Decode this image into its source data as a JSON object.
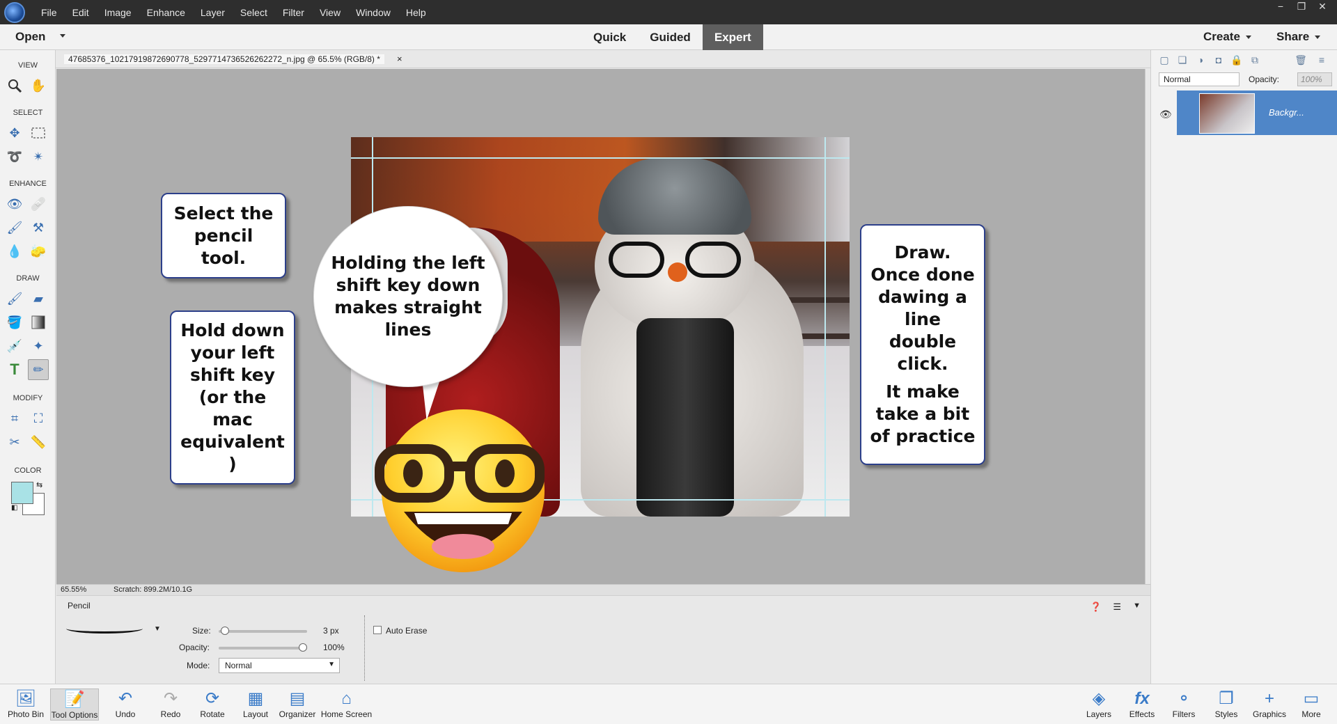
{
  "menubar": {
    "items": [
      "File",
      "Edit",
      "Image",
      "Enhance",
      "Layer",
      "Select",
      "Filter",
      "View",
      "Window",
      "Help"
    ],
    "window_controls": [
      "−",
      "❐",
      "✕"
    ]
  },
  "topbar": {
    "open_label": "Open",
    "modes": [
      "Quick",
      "Guided",
      "Expert"
    ],
    "active_mode": "Expert",
    "create_label": "Create",
    "share_label": "Share"
  },
  "toolbox": {
    "sections": [
      "VIEW",
      "SELECT",
      "ENHANCE",
      "DRAW",
      "MODIFY",
      "COLOR"
    ],
    "foreground_color": "#a9e2e6",
    "background_color": "#ffffff"
  },
  "document": {
    "tab_label": "47685376_10217919872690778_5297714736526262272_n.jpg @ 65.5% (RGB/8) *",
    "close_glyph": "×",
    "zoom": "65.55%",
    "scratch": "Scratch: 899.2M/10.1G"
  },
  "callouts": {
    "select_pencil": "Select the pencil tool.",
    "hold_shift": "Hold down your left shift key (or the mac equivalent )",
    "bubble": "Holding the left shift key down makes straight lines",
    "draw_line": "Draw. Once done dawing a line double click.",
    "practice": "It make take a bit of practice"
  },
  "layers_panel": {
    "blend_mode": "Normal",
    "opacity_label": "Opacity:",
    "opacity_value": "100%",
    "layer_name": "Backgr..."
  },
  "tool_options": {
    "tool_name": "Pencil",
    "size_label": "Size:",
    "size_value": "3 px",
    "size_fraction": 0.03,
    "opacity_label": "Opacity:",
    "opacity_value": "100%",
    "opacity_fraction": 1.0,
    "mode_label": "Mode:",
    "mode_value": "Normal",
    "auto_erase_label": "Auto Erase",
    "auto_erase_checked": false
  },
  "bottombar": {
    "left": [
      {
        "label": "Photo Bin",
        "icon": "photo-bin-icon"
      },
      {
        "label": "Tool Options",
        "icon": "tool-options-icon"
      },
      {
        "label": "Undo",
        "icon": "undo-icon"
      },
      {
        "label": "Redo",
        "icon": "redo-icon"
      },
      {
        "label": "Rotate",
        "icon": "rotate-icon"
      },
      {
        "label": "Layout",
        "icon": "layout-icon"
      },
      {
        "label": "Organizer",
        "icon": "organizer-icon"
      },
      {
        "label": "Home Screen",
        "icon": "home-icon"
      }
    ],
    "right": [
      {
        "label": "Layers",
        "icon": "layers-icon"
      },
      {
        "label": "Effects",
        "icon": "effects-icon"
      },
      {
        "label": "Filters",
        "icon": "filters-icon"
      },
      {
        "label": "Styles",
        "icon": "styles-icon"
      },
      {
        "label": "Graphics",
        "icon": "graphics-icon"
      },
      {
        "label": "More",
        "icon": "more-icon"
      }
    ]
  }
}
